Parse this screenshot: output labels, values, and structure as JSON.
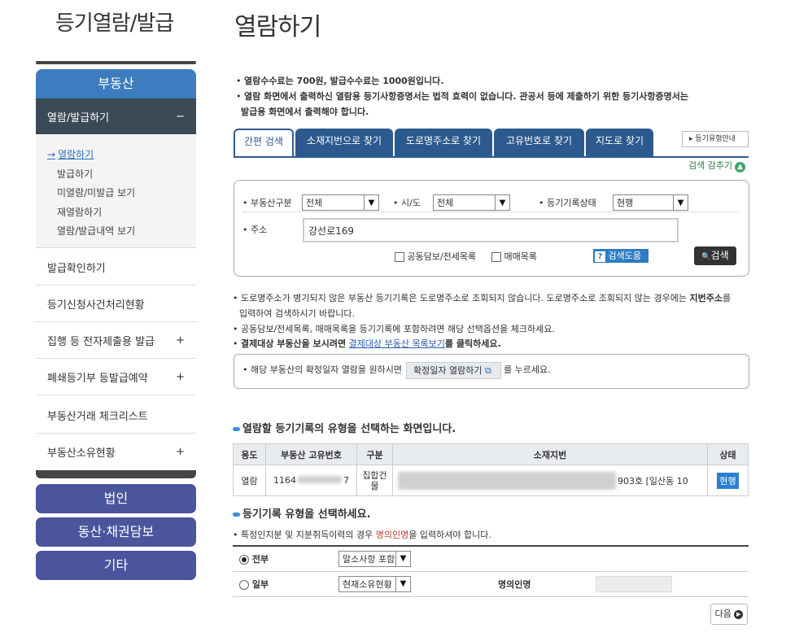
{
  "sidebar": {
    "title": "등기열람/발급",
    "category": "부동산",
    "submenu_title": "열람/발급하기",
    "submenu_toggle": "−",
    "submenu_items": [
      "열람하기",
      "발급하기",
      "미열람/미발급 보기",
      "재열람하기",
      "열람/발급내역 보기"
    ],
    "active_arrow": "→",
    "menus": [
      {
        "label": "발급확인하기",
        "toggle": ""
      },
      {
        "label": "등기신청사건처리현황",
        "toggle": ""
      },
      {
        "label": "집행 등 전자제출용 발급",
        "toggle": "+"
      },
      {
        "label": "폐쇄등기부 등발급예약",
        "toggle": "+"
      },
      {
        "label": "부동산거래 체크리스트",
        "toggle": ""
      },
      {
        "label": "부동산소유현황",
        "toggle": "+"
      }
    ],
    "buttons": [
      "법인",
      "동산·채권담보",
      "기타"
    ]
  },
  "main": {
    "title": "열람하기",
    "notices": [
      "열람수수료는 700원, 발급수수료는 1000원입니다.",
      "열람 화면에서 출력하신 열람용 등기사항증명서는 법적 효력이 없습니다. 관공서 등에 제출하기 위한 등기사항증명서는",
      "발급용 화면에서 출력해야 합니다."
    ],
    "bullet": "•",
    "tabs": [
      "간편 검색",
      "소재지번으로 찾기",
      "도로명주소로 찾기",
      "고유번호로 찾기",
      "지도로 찾기"
    ],
    "tab_guide": "등기유형안내",
    "tab_guide_icon": "▸",
    "collapse_label": "검색 감추기",
    "collapse_icon": "▲",
    "search": {
      "property_label": "부동산구분",
      "property_value": "전체",
      "region_label": "시/도",
      "region_value": "전체",
      "status_label": "등기기록상태",
      "status_value": "현행",
      "address_label": "주소",
      "address_value": "강선로169",
      "joint_label": "공동담보/전세목록",
      "sale_label": "매매목록",
      "help_label": "검색도움말",
      "help_icon": "?",
      "search_label": "검색",
      "search_icon": "🔍",
      "dropdown_icon": "▼"
    },
    "info": {
      "line1": "도로명주소가 병기되지 않은 부동산 등기기록은 도로명주소로 조회되지 않습니다. 도로명주소로 조회되지 않는 경우에는",
      "line1_bold": "지번주소",
      "line1_end": "를",
      "line2": "입력하여 검색하시기 바랍니다.",
      "line3": "공동담보/전세목록, 매매목록을 등기기록에 포함하려면 해당 선택옵션을 체크하세요.",
      "line4_a": "결제대상 부동산을 보시려면",
      "line4_link": "결제대상 부동산 목록보기",
      "line4_b": "를 클릭하세요."
    },
    "confirm": {
      "text_a": "해당 부동산의 확정일자 열람을 원하시면",
      "button": "확정일자 열람하기",
      "button_icon": "⧉",
      "text_b": "를 누르세요."
    },
    "section1": "열람할 등기기록의 유형을 선택하는 화면입니다.",
    "record_table": {
      "headers": [
        "용도",
        "부동산 고유번호",
        "구분",
        "소재지번",
        "상태"
      ],
      "row": {
        "use": "열람",
        "id_a": "1164",
        "id_b": "7",
        "kind": "집합건물",
        "addr_visible": "903호 [일산동 10",
        "status": "현행"
      }
    },
    "section2": "등기기록 유형을 선택하세요.",
    "type_note_a": "특정인지분 및 지분취득이력의 경우",
    "type_note_red": "명의인명",
    "type_note_b": "을 입력하셔야 합니다.",
    "type_table": {
      "full_label": "전부",
      "full_option": "말소사항 포함",
      "partial_label": "일부",
      "partial_option": "현재소유현황",
      "owner_label": "명의인명"
    },
    "next_label": "다음",
    "next_icon": "▶"
  }
}
